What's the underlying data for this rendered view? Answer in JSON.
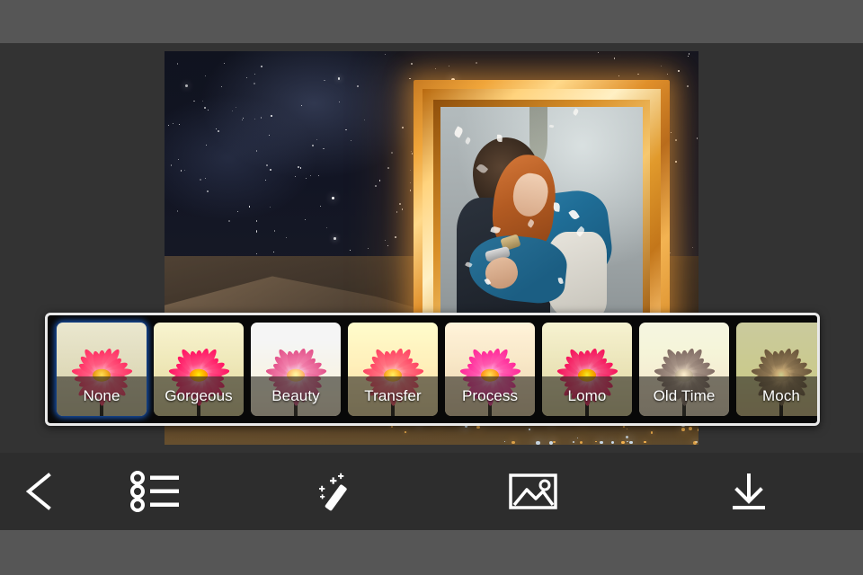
{
  "app": {
    "screen_name": "photo-filter-editor",
    "background_color": "#333333",
    "chrome_bar_color": "#565656",
    "toolbar_color": "#2d2d2d"
  },
  "canvas": {
    "name": "edited-photo-preview",
    "description": "Starry night sky over an illuminated hillside town with an ornate gold picture frame containing a photo of a couple embracing"
  },
  "filter_strip": {
    "name": "filter-carousel",
    "selected_index": 0,
    "selection_color": "#1565e0",
    "border_color": "#e9e9e9",
    "filters": [
      {
        "label": "None",
        "grade": "g-none",
        "selected": true
      },
      {
        "label": "Gorgeous",
        "grade": "g-gorgeous",
        "selected": false
      },
      {
        "label": "Beauty",
        "grade": "g-beauty",
        "selected": false
      },
      {
        "label": "Transfer",
        "grade": "g-transfer",
        "selected": false
      },
      {
        "label": "Process",
        "grade": "g-process",
        "selected": false
      },
      {
        "label": "Lomo",
        "grade": "g-lomo",
        "selected": false
      },
      {
        "label": "Old Time",
        "grade": "g-oldtime",
        "selected": false
      },
      {
        "label": "Moch",
        "grade": "g-mocha",
        "selected": false
      }
    ]
  },
  "toolbar": {
    "name": "bottom-toolbar",
    "items": [
      {
        "icon": "back-chevron-icon",
        "label": "Back"
      },
      {
        "icon": "list-icon",
        "label": "Frames"
      },
      {
        "icon": "magic-wand-icon",
        "label": "Effects"
      },
      {
        "icon": "image-icon",
        "label": "Photos"
      },
      {
        "icon": "download-icon",
        "label": "Save"
      }
    ]
  }
}
